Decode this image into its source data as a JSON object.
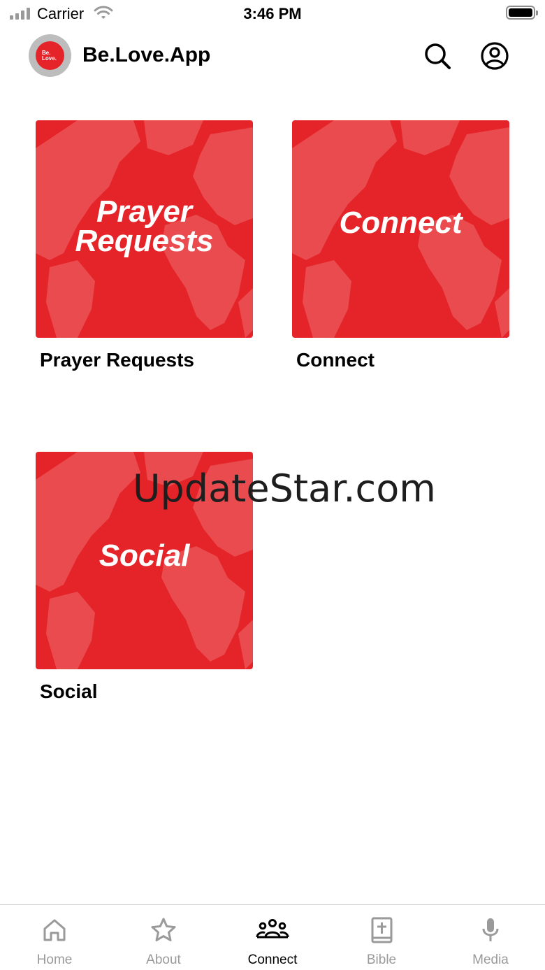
{
  "status_bar": {
    "carrier": "Carrier",
    "time": "3:46 PM"
  },
  "header": {
    "logo_text_line1": "Be.",
    "logo_text_line2": "Love.",
    "title": "Be.Love.App",
    "search_icon": "search-icon",
    "profile_icon": "profile-icon"
  },
  "tiles": [
    {
      "image_word_line1": "Prayer",
      "image_word_line2": "Requests",
      "label": "Prayer Requests"
    },
    {
      "image_word_line1": "Connect",
      "image_word_line2": "",
      "label": "Connect"
    },
    {
      "image_word_line1": "Social",
      "image_word_line2": "",
      "label": "Social"
    }
  ],
  "watermark": "UpdateStar.com",
  "tab_bar": {
    "active": "Connect",
    "tabs": [
      {
        "label": "Home",
        "icon": "home-icon"
      },
      {
        "label": "About",
        "icon": "star-icon"
      },
      {
        "label": "Connect",
        "icon": "people-icon"
      },
      {
        "label": "Bible",
        "icon": "bible-icon"
      },
      {
        "label": "Media",
        "icon": "microphone-icon"
      }
    ]
  },
  "colors": {
    "brand_red": "#e52429",
    "inactive_gray": "#9a9a9a"
  }
}
